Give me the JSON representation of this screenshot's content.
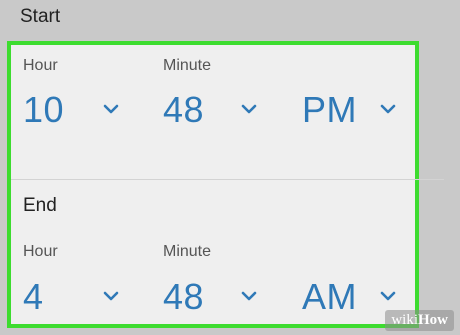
{
  "start": {
    "title": "Start",
    "hour_label": "Hour",
    "minute_label": "Minute",
    "hour_value": "10",
    "minute_value": "48",
    "ampm_value": "PM"
  },
  "end": {
    "title": "End",
    "hour_label": "Hour",
    "minute_label": "Minute",
    "hour_value": "4",
    "minute_value": "48",
    "ampm_value": "AM"
  },
  "watermark": {
    "prefix": "wiki",
    "suffix": "How"
  },
  "colors": {
    "value_blue": "#2f79b7",
    "highlight_green": "#3ddc2f",
    "panel_bg": "#efefef",
    "page_bg": "#c9c9c9"
  },
  "icons": {
    "dropdown": "chevron-down-icon"
  }
}
